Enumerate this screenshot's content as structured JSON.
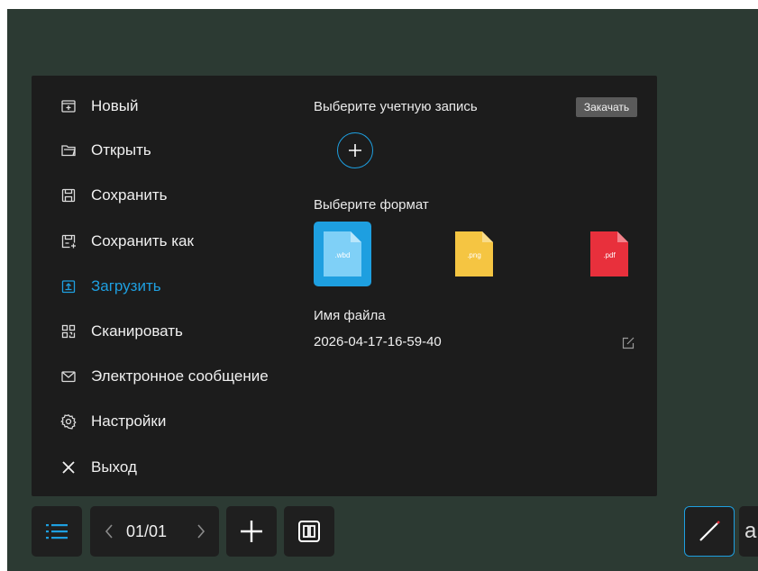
{
  "menu": {
    "items": [
      {
        "label": "Новый",
        "icon": "new-file-icon"
      },
      {
        "label": "Открыть",
        "icon": "open-folder-icon"
      },
      {
        "label": "Сохранить",
        "icon": "save-icon"
      },
      {
        "label": "Сохранить как",
        "icon": "save-as-icon"
      },
      {
        "label": "Загрузить",
        "icon": "upload-icon",
        "active": true
      },
      {
        "label": "Сканировать",
        "icon": "qr-scan-icon"
      },
      {
        "label": "Электронное сообщение",
        "icon": "mail-icon"
      },
      {
        "label": "Настройки",
        "icon": "gear-icon"
      },
      {
        "label": "Выход",
        "icon": "close-icon"
      }
    ]
  },
  "upload": {
    "account_label": "Выберите учетную запись",
    "upload_button": "Закачать",
    "format_label": "Выберите формат",
    "formats": [
      {
        "ext": ".wbd",
        "color": "#7fd0f7",
        "selected": true
      },
      {
        "ext": ".png",
        "color": "#f5c542",
        "selected": false
      },
      {
        "ext": ".pdf",
        "color": "#e8303c",
        "selected": false
      }
    ],
    "filename_label": "Имя файла",
    "filename_value": "2026-04-17-16-59-40"
  },
  "toolbar": {
    "page_indicator": "01/01",
    "next_tool_glyph": "a"
  },
  "colors": {
    "accent": "#1e9fe0",
    "board": "#2c3a33",
    "panel": "#1c1c1c"
  }
}
